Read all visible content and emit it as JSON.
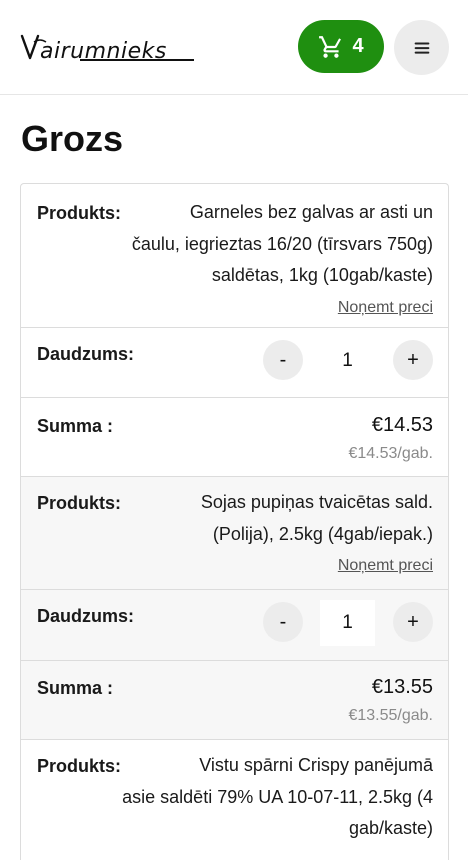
{
  "header": {
    "logo_text": "Vairumnieks",
    "cart_count": "4",
    "cart_icon": "cart-icon",
    "menu_icon": "hamburger-menu-icon"
  },
  "page": {
    "title": "Grozs"
  },
  "labels": {
    "product": "Produkts:",
    "quantity": "Daudzums:",
    "sum": "Summa :",
    "remove": "Noņemt preci",
    "minus": "-",
    "plus": "+"
  },
  "items": [
    {
      "name_lines": [
        "Garneles bez galvas ar asti un",
        "čaulu, iegrieztas 16/20 (tīrsvars 750g)",
        "saldētas, 1kg (10gab/kaste)"
      ],
      "quantity": "1",
      "total": "€14.53",
      "unit_price": "€14.53/gab."
    },
    {
      "name_lines": [
        "Sojas pupiņas tvaicētas sald.",
        "(Polija), 2.5kg (4gab/iepak.)"
      ],
      "quantity": "1",
      "total": "€13.55",
      "unit_price": "€13.55/gab."
    },
    {
      "name_lines": [
        "Vistu spārni Crispy panējumā",
        "asie saldēti 79% UA 10-07-11, 2.5kg (4",
        "gab/kaste)"
      ]
    }
  ],
  "colors": {
    "cart_button": "#1f8f10",
    "menu_button": "#ececec"
  }
}
